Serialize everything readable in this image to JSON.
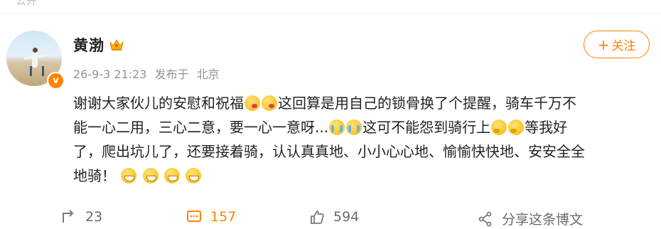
{
  "top_clip_text": "公开",
  "post": {
    "author": "黄渤",
    "timestamp": "26-9-3 21:23",
    "source": "发布于",
    "location": "北京",
    "follow_label": "关注",
    "text": [
      "谢谢大家伙儿的安慰和祝福",
      "这回算是用自己的锁骨换了个提醒，骑车千万不",
      "能一心二用，三心二意，要一心一意呀...",
      "这可不能怨到骑行上",
      "等我好",
      "了，爬出坑儿了，还要接着骑，认认真真地、小小心心地、愉愉快快地、安安全全",
      "地骑！"
    ]
  },
  "actions": {
    "repost_count": "23",
    "comment_count": "157",
    "like_count": "594",
    "share_label": "分享这条博文"
  },
  "colors": {
    "accent": "#ff8200",
    "meta": "#939393"
  },
  "icons": [
    "crown-icon",
    "verified-icon",
    "repost-icon",
    "comment-icon",
    "like-icon",
    "share-icon"
  ]
}
